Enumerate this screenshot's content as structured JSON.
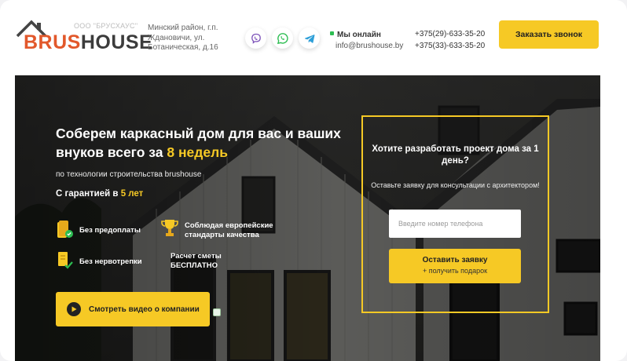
{
  "header": {
    "logo": {
      "company": "ООО \"БРУСХАУС\"",
      "word_part1": "BRUS",
      "word_part2": "HOUSE"
    },
    "address": "Минский район, г.п. Ждановичи, ул. Ботаническая, д.16",
    "messengers": [
      "viber-icon",
      "whatsapp-icon",
      "telegram-icon"
    ],
    "online_status": "Мы онлайн",
    "email": "info@brushouse.by",
    "phones": [
      "+375(29)-633-35-20",
      "+375(33)-633-35-20"
    ],
    "call_button": "Заказать звонок"
  },
  "hero": {
    "title_part1": "Соберем каркасный дом для вас и ваших внуков всего за ",
    "title_highlight": "8 недель",
    "subtitle": "по технологии строительства brushouse",
    "guarantee_prefix": "С гарантией в ",
    "guarantee_highlight": "5 лет",
    "features": [
      {
        "icon": "coins-icon",
        "text": "Без предоплаты"
      },
      {
        "icon": "trophy-icon",
        "text": "Соблюдая европейские стандарты качества"
      },
      {
        "icon": "document-check-icon",
        "text": "Без нервотрепки"
      },
      {
        "icon": "",
        "text": "Расчет сметы БЕСПЛАТНО"
      }
    ],
    "video_button": "Смотреть видео о компании"
  },
  "form": {
    "question": "Хотите разработать проект дома за 1 день?",
    "subtext": "Оставьте заявку для консультации с архитектором!",
    "phone_placeholder": "Введите номер телефона",
    "submit_label": "Оставить заявку",
    "submit_sublabel": "+ получить подарок"
  },
  "colors": {
    "accent": "#f6c925",
    "logo_orange": "#e2582b",
    "online": "#2dbd52"
  }
}
